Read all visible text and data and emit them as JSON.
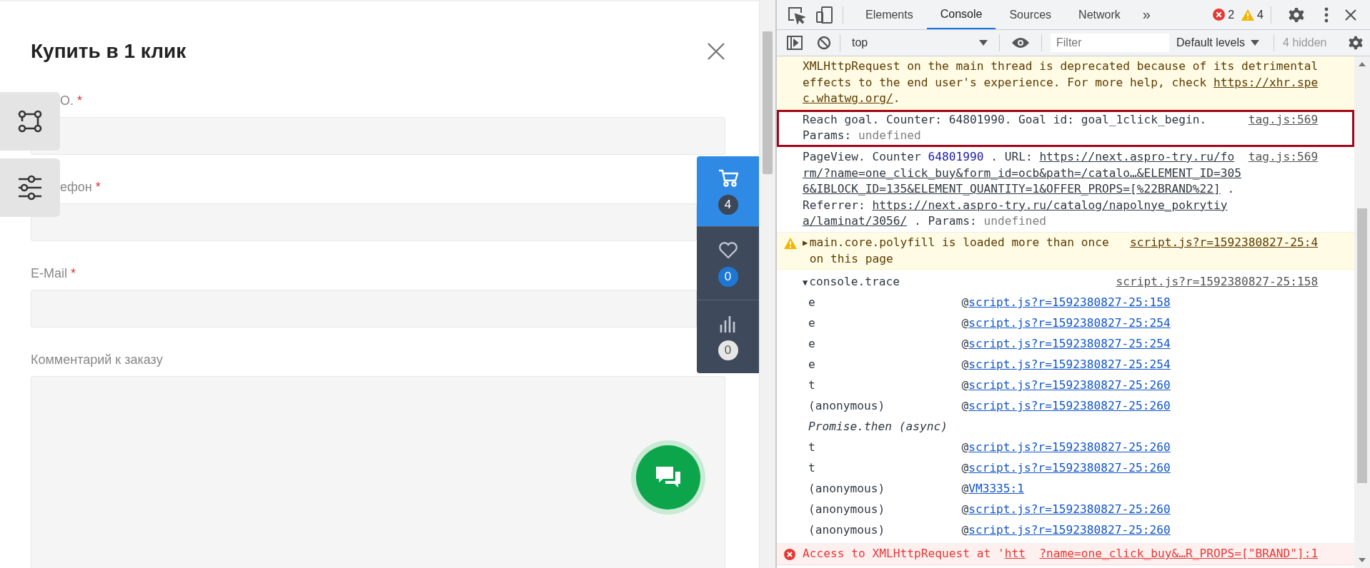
{
  "modal": {
    "title": "Купить в 1 клик",
    "fields": [
      {
        "kind": "input",
        "label": "О.",
        "required_mark": "*"
      },
      {
        "kind": "input",
        "label": "ефон",
        "required_mark": "*"
      },
      {
        "kind": "input",
        "label": "E-Mail",
        "required_mark": "*"
      },
      {
        "kind": "textarea",
        "label": "Комментарий к заказу"
      }
    ]
  },
  "widget": {
    "items": [
      {
        "kind": "cart",
        "selected": true,
        "count": "4",
        "color": "#3b4656"
      },
      {
        "kind": "favorites",
        "selected": false,
        "count": "0",
        "color": "#1e77d3"
      },
      {
        "kind": "compare",
        "selected": false,
        "count": "0",
        "color": "#e6e6e6"
      }
    ]
  },
  "devtools": {
    "tabs": [
      {
        "label": "Elements",
        "selected": false
      },
      {
        "label": "Console",
        "selected": true
      },
      {
        "label": "Sources",
        "selected": false
      },
      {
        "label": "Network",
        "selected": false
      }
    ],
    "more_tabs": "»",
    "error_count": "2",
    "warning_count": "4",
    "context": "top",
    "filter": {
      "placeholder": "Filter"
    },
    "levels": "Default levels",
    "hidden_count": "4 hidden"
  },
  "console": {
    "messages": [
      {
        "kind": "warning",
        "highlighted": false,
        "parts": [
          {
            "kind": "plain",
            "text": "XMLHttpRequest on the main thread is deprecated because of its detrimental effects to the end user's experience. For more help, check "
          },
          {
            "kind": "link",
            "text": "https://xhr.spec.whatwg.org/"
          },
          {
            "kind": "plain",
            "text": "."
          }
        ]
      },
      {
        "kind": "log",
        "highlighted": true,
        "source": "tag.js:569",
        "parts": [
          {
            "kind": "plain",
            "text": "Reach goal. Counter: 64801990. Goal id: goal_1click_begin. Params: "
          },
          {
            "kind": "dim",
            "text": "undefined"
          }
        ]
      },
      {
        "kind": "log",
        "highlighted": false,
        "source": "tag.js:569",
        "parts": [
          {
            "kind": "plain",
            "text": "PageView. Counter  "
          },
          {
            "kind": "number",
            "text": "64801990"
          },
          {
            "kind": "plain",
            "text": " . URL:  "
          },
          {
            "kind": "link",
            "text": "https://next.aspro-try.ru/form/?name=one_click_buy&form_id=ocb&path=/catalo…&ELEMENT_ID=3056&IBLOCK_ID=135&ELEMENT_QUANTITY=1&OFFER_PROPS=[%22BRAND%22]"
          },
          {
            "kind": "plain",
            "text": " . Referrer: "
          },
          {
            "kind": "link",
            "text": "https://next.aspro-try.ru/catalog/napolnye_pokrytiya/laminat/3056/"
          },
          {
            "kind": "plain",
            "text": " . Params: "
          },
          {
            "kind": "dim",
            "text": "undefined"
          }
        ]
      },
      {
        "kind": "warning",
        "highlighted": false,
        "toggle": "▶",
        "source": "script.js?r=1592380827-25:4",
        "parts": [
          {
            "kind": "plain",
            "text": "main.core.polyfill is loaded more than once on this page"
          }
        ]
      },
      {
        "kind": "trace",
        "highlighted": false,
        "toggle": "▼",
        "title": "console.trace",
        "source": "script.js?r=1592380827-25:158",
        "frames": [
          {
            "kind": "frame",
            "fn": "e",
            "at": "@",
            "loc": "script.js?r=1592380827-25:158"
          },
          {
            "kind": "frame",
            "fn": "e",
            "at": "@",
            "loc": "script.js?r=1592380827-25:254"
          },
          {
            "kind": "frame",
            "fn": "e",
            "at": "@",
            "loc": "script.js?r=1592380827-25:254"
          },
          {
            "kind": "frame",
            "fn": "e",
            "at": "@",
            "loc": "script.js?r=1592380827-25:254"
          },
          {
            "kind": "frame",
            "fn": "t",
            "at": "@",
            "loc": "script.js?r=1592380827-25:260"
          },
          {
            "kind": "frame",
            "fn": "(anonymous)",
            "at": "@",
            "loc": "script.js?r=1592380827-25:260"
          },
          {
            "kind": "async",
            "label": "Promise.then (async)"
          },
          {
            "kind": "frame",
            "fn": "t",
            "at": "@",
            "loc": "script.js?r=1592380827-25:260"
          },
          {
            "kind": "frame",
            "fn": "t",
            "at": "@",
            "loc": "script.js?r=1592380827-25:260"
          },
          {
            "kind": "frame",
            "fn": "(anonymous)",
            "at": "@",
            "loc": "VM3335:1"
          },
          {
            "kind": "frame",
            "fn": "(anonymous)",
            "at": "@",
            "loc": "script.js?r=1592380827-25:260"
          },
          {
            "kind": "frame",
            "fn": "(anonymous)",
            "at": "@",
            "loc": "script.js?r=1592380827-25:260"
          }
        ]
      },
      {
        "kind": "error",
        "highlighted": false,
        "source": "?name=one_click_buy&…R_PROPS=[\"BRAND\"]:1",
        "parts": [
          {
            "kind": "plain",
            "text": "Access to XMLHttpRequest at '"
          },
          {
            "kind": "link",
            "text": "htt"
          }
        ]
      }
    ]
  }
}
